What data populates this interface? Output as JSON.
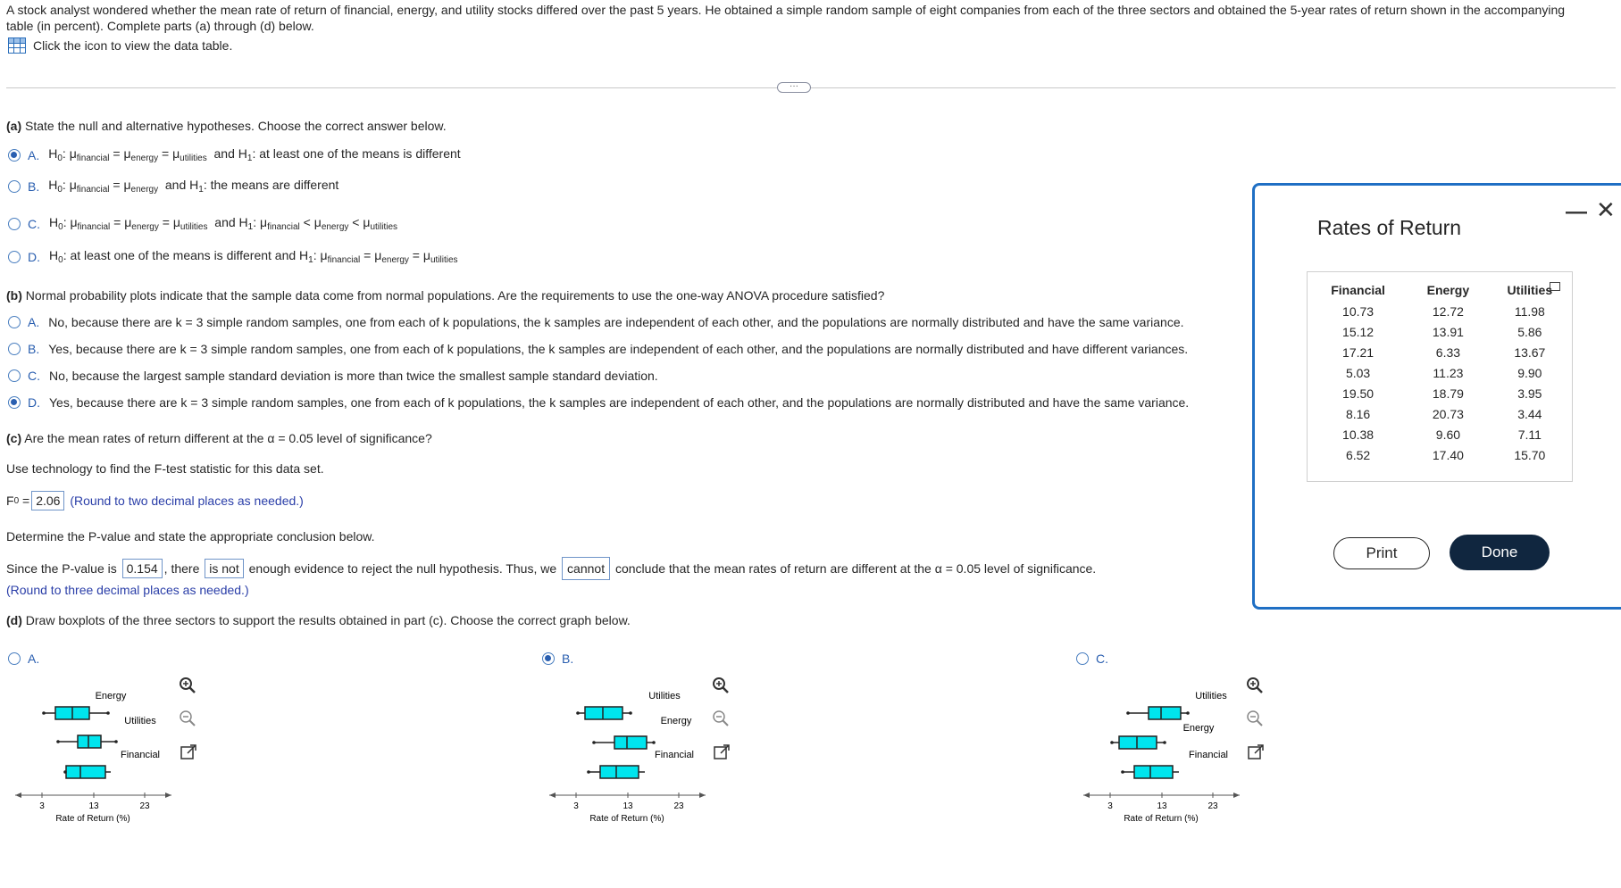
{
  "intro": {
    "text": "A stock analyst wondered whether the mean rate of return of financial, energy, and utility stocks differed over the past 5 years. He obtained a simple random sample of eight companies from each of the three sectors and obtained the 5-year rates of return shown in the accompanying table (in percent). Complete parts (a) through (d) below.",
    "view_data_label": "Click the icon to view the data table."
  },
  "part_a": {
    "question": "(a) State the null and alternative hypotheses. Choose the correct answer below.",
    "options": [
      {
        "letter": "A.",
        "selected": true,
        "h0": "H",
        "text_h0_mid": ": μ",
        "s1": "financial",
        "s2": "energy",
        "s3": "utilities",
        "h1_text": "and H",
        "h1_rest": ": at least one of the means is different"
      },
      {
        "letter": "B.",
        "selected": false
      },
      {
        "letter": "C.",
        "selected": false
      },
      {
        "letter": "D.",
        "selected": false
      }
    ],
    "label_and_h1": "and H",
    "a_h1_rest": ": at least one of the means is different",
    "b_h1_rest": ": the means are different",
    "d_h0_rest": ": at least one of the means is different and H",
    "sub_0": "0",
    "sub_1": "1",
    "mu": "μ",
    "sub_fin": "financial",
    "sub_en": "energy",
    "sub_ut": "utilities",
    "colon": ":",
    "eq": "=",
    "lt": "<"
  },
  "part_b": {
    "question": "(b) Normal probability plots indicate that the sample data come from normal populations. Are the requirements to use the one-way ANOVA procedure satisfied?",
    "options": [
      {
        "letter": "A.",
        "selected": false,
        "text": "No, because there are k = 3 simple random samples, one from each of k populations, the k samples are independent of each other, and the populations are normally distributed and have the same variance."
      },
      {
        "letter": "B.",
        "selected": false,
        "text": "Yes, because there are k = 3 simple random samples, one from each of k populations, the k samples are independent of each other, and the populations are normally distributed and have different variances."
      },
      {
        "letter": "C.",
        "selected": false,
        "text": "No, because the largest sample standard deviation is more than twice the smallest sample standard deviation."
      },
      {
        "letter": "D.",
        "selected": true,
        "text": "Yes, because there are k = 3 simple random samples, one from each of k populations, the k samples are independent of each other, and the populations are normally distributed and have the same variance."
      }
    ]
  },
  "part_c": {
    "question": "(c) Are the mean rates of return different at the α = 0.05 level of significance?",
    "tech": "Use technology to find the F-test statistic for this data set.",
    "f_label": "F",
    "f_sub": "0",
    "f_eq": "=",
    "f_value": "2.06",
    "f_hint": "(Round to two decimal places as needed.)",
    "determine": "Determine the P-value and state the appropriate conclusion below.",
    "since": "Since the P-value is",
    "p_value": "0.154",
    "there": ", there",
    "is_not": "is not",
    "enough": "enough evidence to reject the null hypothesis. Thus, we",
    "cannot": "cannot",
    "conclude": "conclude that the mean rates of return are different at the α = 0.05 level of significance.",
    "p_hint": "(Round to three decimal places as needed.)"
  },
  "part_d": {
    "question": "(d) Draw boxplots of the three sectors to support the results obtained in part (c). Choose the correct graph below.",
    "graphs": [
      {
        "letter": "A.",
        "selected": false,
        "labels": [
          "Energy",
          "Utilities",
          "Financial"
        ],
        "ticks": [
          "3",
          "13",
          "23"
        ],
        "xlabel": "Rate of Return (%)"
      },
      {
        "letter": "B.",
        "selected": true,
        "labels": [
          "Utilities",
          "Energy",
          "Financial"
        ],
        "ticks": [
          "3",
          "13",
          "23"
        ],
        "xlabel": "Rate of Return (%)"
      },
      {
        "letter": "C.",
        "selected": false,
        "labels": [
          "Utilities",
          "Energy",
          "Financial"
        ],
        "ticks": [
          "3",
          "13",
          "23"
        ],
        "xlabel": "Rate of Return (%)"
      }
    ]
  },
  "panel": {
    "title": "Rates of Return",
    "columns": [
      "Financial",
      "Energy",
      "Utilities"
    ],
    "rows": [
      [
        "10.73",
        "12.72",
        "11.98"
      ],
      [
        "15.12",
        "13.91",
        "5.86"
      ],
      [
        "17.21",
        "6.33",
        "13.67"
      ],
      [
        "5.03",
        "11.23",
        "9.90"
      ],
      [
        "19.50",
        "18.79",
        "3.95"
      ],
      [
        "8.16",
        "20.73",
        "3.44"
      ],
      [
        "10.38",
        "9.60",
        "7.11"
      ],
      [
        "6.52",
        "17.40",
        "15.70"
      ]
    ],
    "print_label": "Print",
    "done_label": "Done",
    "minimize_glyph": "—",
    "close_glyph": "✕"
  },
  "icons": {
    "more": "···"
  },
  "colors": {
    "box_fill": "#00e5ee",
    "panel_border": "#1f6fc4",
    "done_bg": "#10263f",
    "link_blue": "#2a3ea8"
  }
}
